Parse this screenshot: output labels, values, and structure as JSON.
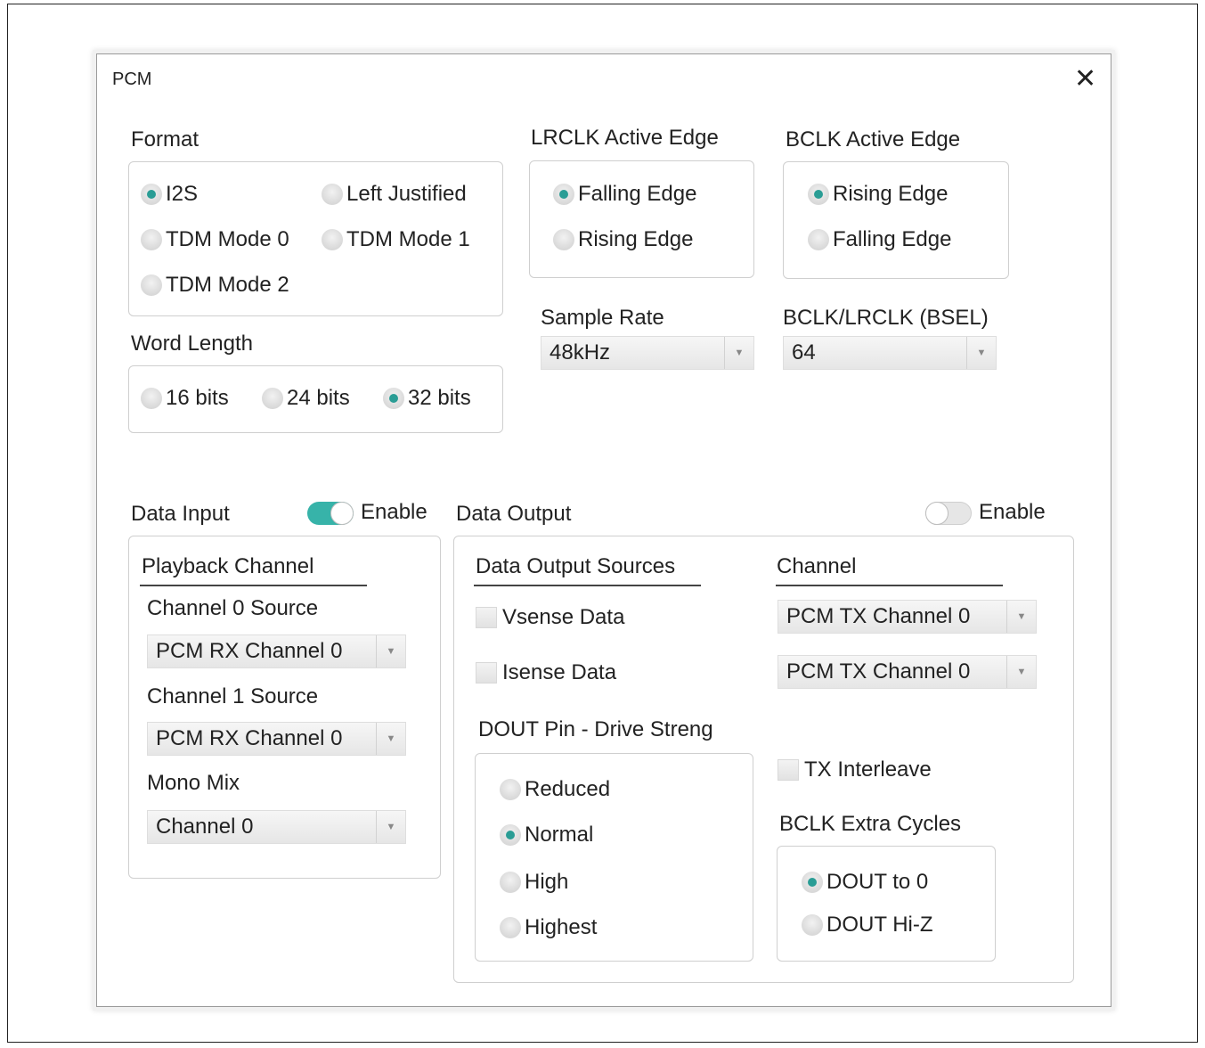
{
  "dialog": {
    "title": "PCM",
    "close_glyph": "✕"
  },
  "format": {
    "label": "Format",
    "options": [
      {
        "label": "I2S",
        "selected": true
      },
      {
        "label": "Left Justified",
        "selected": false
      },
      {
        "label": "TDM Mode 0",
        "selected": false
      },
      {
        "label": "TDM Mode 1",
        "selected": false
      },
      {
        "label": "TDM Mode 2",
        "selected": false
      }
    ]
  },
  "lrclk": {
    "label": "LRCLK Active Edge",
    "options": [
      {
        "label": "Falling Edge",
        "selected": true
      },
      {
        "label": "Rising Edge",
        "selected": false
      }
    ]
  },
  "bclk": {
    "label": "BCLK Active Edge",
    "options": [
      {
        "label": "Rising Edge",
        "selected": true
      },
      {
        "label": "Falling Edge",
        "selected": false
      }
    ]
  },
  "word_length": {
    "label": "Word Length",
    "options": [
      {
        "label": "16 bits",
        "selected": false
      },
      {
        "label": "24 bits",
        "selected": false
      },
      {
        "label": "32 bits",
        "selected": true
      }
    ]
  },
  "sample_rate": {
    "label": "Sample Rate",
    "value": "48kHz"
  },
  "bsel": {
    "label": "BCLK/LRCLK (BSEL)",
    "value": "64"
  },
  "data_input": {
    "label": "Data Input",
    "enable_label": "Enable",
    "enabled": true,
    "playback_header": "Playback Channel",
    "ch0_label": "Channel 0 Source",
    "ch0_value": "PCM RX Channel 0",
    "ch1_label": "Channel 1 Source",
    "ch1_value": "PCM RX Channel 0",
    "mono_label": "Mono Mix",
    "mono_value": "Channel 0"
  },
  "data_output": {
    "label": "Data Output",
    "enable_label": "Enable",
    "enabled": false,
    "sources_header": "Data Output Sources",
    "channel_header": "Channel",
    "vsense_label": "Vsense Data",
    "vsense_checked": false,
    "isense_label": "Isense Data",
    "isense_checked": false,
    "vsense_channel": "PCM TX Channel 0",
    "isense_channel": "PCM TX Channel 0",
    "drive_label": "DOUT Pin - Drive Streng",
    "drive_options": [
      {
        "label": "Reduced",
        "selected": false
      },
      {
        "label": "Normal",
        "selected": true
      },
      {
        "label": "High",
        "selected": false
      },
      {
        "label": "Highest",
        "selected": false
      }
    ],
    "tx_interleave_label": "TX Interleave",
    "tx_interleave_checked": false,
    "bclk_extra_label": "BCLK Extra Cycles",
    "bclk_extra_options": [
      {
        "label": "DOUT to 0",
        "selected": true
      },
      {
        "label": "DOUT Hi-Z",
        "selected": false
      }
    ]
  },
  "icons": {
    "dropdown": "chevron-down-icon",
    "close": "close-icon"
  },
  "colors": {
    "accent": "#2a9d95",
    "toggle_on": "#37b3a9"
  }
}
